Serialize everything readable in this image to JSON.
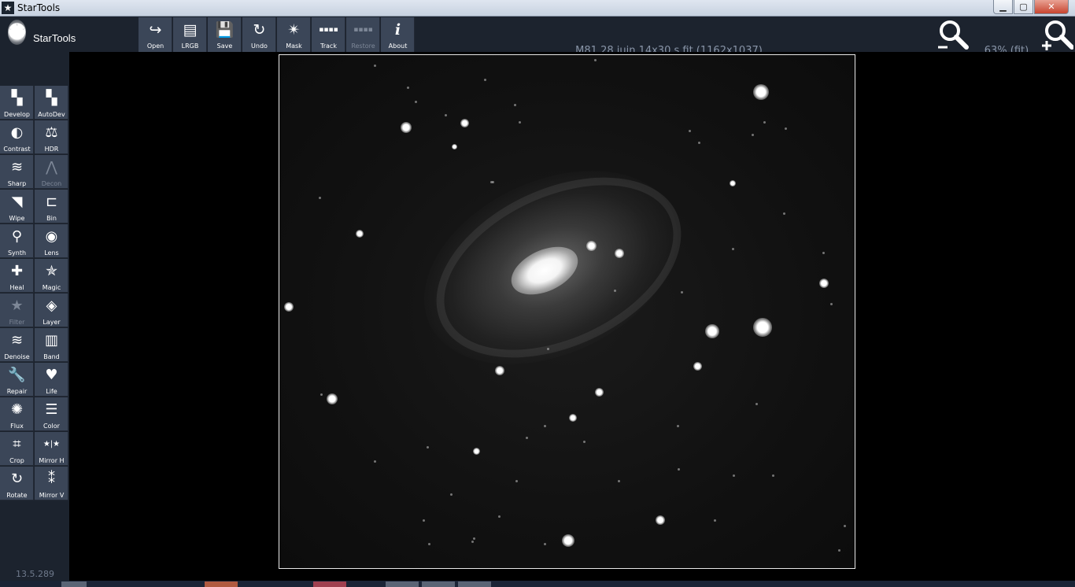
{
  "window": {
    "title": "StarTools",
    "buttons": {
      "minimize": "▁",
      "maximize": "▢",
      "close": "✕"
    }
  },
  "app": {
    "logo_text": "StarTools",
    "version": "13.5.289"
  },
  "toolbar": [
    {
      "id": "open",
      "label": "Open",
      "icon": "open-icon",
      "glyph": "↪",
      "enabled": true
    },
    {
      "id": "lrgb",
      "label": "LRGB",
      "icon": "lrgb-icon",
      "glyph": "▤",
      "enabled": true
    },
    {
      "id": "save",
      "label": "Save",
      "icon": "save-icon",
      "glyph": "💾",
      "enabled": true
    },
    {
      "id": "undo",
      "label": "Undo",
      "icon": "undo-icon",
      "glyph": "↻",
      "enabled": true
    },
    {
      "id": "mask",
      "label": "Mask",
      "icon": "mask-icon",
      "glyph": "✴",
      "enabled": true
    },
    {
      "id": "track",
      "label": "Track",
      "icon": "track-icon",
      "glyph": "▪▪▪▪",
      "enabled": true
    },
    {
      "id": "restore",
      "label": "Restore",
      "icon": "restore-icon",
      "glyph": "▪▪▪▪",
      "enabled": false
    },
    {
      "id": "about",
      "label": "About",
      "icon": "info-icon",
      "glyph": "i",
      "enabled": true
    }
  ],
  "document": {
    "title": "M81 28  juin 14x30 s.fit (1162x1037)",
    "zoom": "63% (fit)"
  },
  "sidebar": [
    {
      "label": "Develop",
      "icon": "develop-icon",
      "glyph": "▚",
      "enabled": true
    },
    {
      "label": "AutoDev",
      "icon": "autodev-icon",
      "glyph": "▚",
      "enabled": true
    },
    {
      "label": "Contrast",
      "icon": "contrast-icon",
      "glyph": "◐",
      "enabled": true
    },
    {
      "label": "HDR",
      "icon": "hdr-scale-icon",
      "glyph": "⚖",
      "enabled": true
    },
    {
      "label": "Sharp",
      "icon": "sharp-icon",
      "glyph": "≋",
      "enabled": true
    },
    {
      "label": "Decon",
      "icon": "decon-icon",
      "glyph": "⋀",
      "enabled": false
    },
    {
      "label": "Wipe",
      "icon": "wipe-icon",
      "glyph": "◥",
      "enabled": true
    },
    {
      "label": "Bin",
      "icon": "bin-icon",
      "glyph": "⊏",
      "enabled": true
    },
    {
      "label": "Synth",
      "icon": "telescope-icon",
      "glyph": "⚲",
      "enabled": true
    },
    {
      "label": "Lens",
      "icon": "camera-icon",
      "glyph": "◉",
      "enabled": true
    },
    {
      "label": "Heal",
      "icon": "heal-plus-icon",
      "glyph": "✚",
      "enabled": true
    },
    {
      "label": "Magic",
      "icon": "magic-star-icon",
      "glyph": "✯",
      "enabled": true
    },
    {
      "label": "Filter",
      "icon": "filter-star-icon",
      "glyph": "★",
      "enabled": false
    },
    {
      "label": "Layer",
      "icon": "layer-icon",
      "glyph": "◈",
      "enabled": true
    },
    {
      "label": "Denoise",
      "icon": "denoise-icon",
      "glyph": "≋",
      "enabled": true
    },
    {
      "label": "Band",
      "icon": "band-icon",
      "glyph": "▥",
      "enabled": true
    },
    {
      "label": "Repair",
      "icon": "wrench-icon",
      "glyph": "🔧",
      "enabled": true
    },
    {
      "label": "Life",
      "icon": "heart-icon",
      "glyph": "♥",
      "enabled": true
    },
    {
      "label": "Flux",
      "icon": "flux-icon",
      "glyph": "✺",
      "enabled": true
    },
    {
      "label": "Color",
      "icon": "color-sliders-icon",
      "glyph": "☰",
      "enabled": true
    },
    {
      "label": "Crop",
      "icon": "crop-icon",
      "glyph": "⌗",
      "enabled": true
    },
    {
      "label": "Mirror H",
      "icon": "mirror-h-icon",
      "glyph": "★|★",
      "enabled": true
    },
    {
      "label": "Rotate",
      "icon": "rotate-icon",
      "glyph": "↻",
      "enabled": true
    },
    {
      "label": "Mirror V",
      "icon": "mirror-v-icon",
      "glyph": "⁑",
      "enabled": true
    }
  ]
}
